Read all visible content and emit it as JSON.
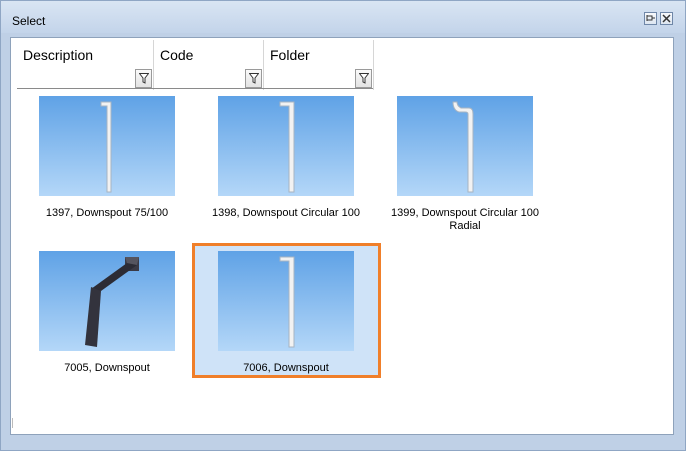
{
  "window": {
    "title": "Select",
    "pin_icon": "pin-icon",
    "close_icon": "close-icon"
  },
  "columns": [
    {
      "label": "Description",
      "filter_icon": "filter-icon"
    },
    {
      "label": "Code",
      "filter_icon": "filter-icon"
    },
    {
      "label": "Folder",
      "filter_icon": "filter-icon"
    }
  ],
  "items": [
    {
      "caption": "1397, Downspout 75/100",
      "icon": "white-pipe-downspout",
      "selected": false
    },
    {
      "caption": "1398, Downspout Circular 100",
      "icon": "white-pipe-downspout",
      "selected": false
    },
    {
      "caption_line1": "1399, Downspout Circular 100",
      "caption_line2": "Radial",
      "icon": "white-pipe-downspout",
      "selected": false
    },
    {
      "caption": "7005, Downspout",
      "icon": "dark-square-downspout",
      "selected": false
    },
    {
      "caption": "7006, Downspout",
      "icon": "white-pipe-downspout",
      "selected": true
    }
  ],
  "colors": {
    "selection_border": "#f07f2a",
    "selection_fill": "#cfe3f8",
    "thumbnail_top": "#5fa2e6",
    "thumbnail_bottom": "#b4d7f8"
  }
}
